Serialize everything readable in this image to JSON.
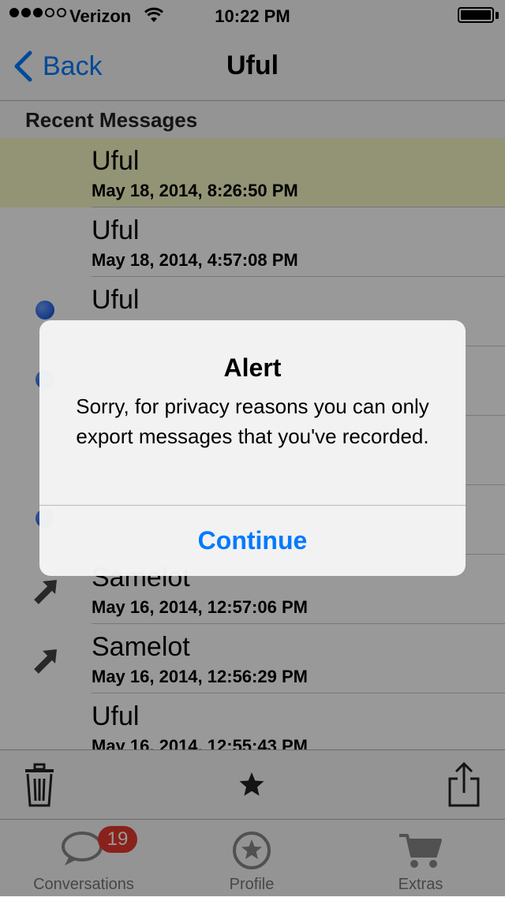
{
  "status_bar": {
    "carrier": "Verizon",
    "time": "10:22 PM",
    "signal_bars": 3,
    "signal_total": 5
  },
  "nav": {
    "back_label": "Back",
    "title": "Uful"
  },
  "section": {
    "title": "Recent Messages"
  },
  "messages": [
    {
      "name": "Uful",
      "date": "May 18, 2014, 8:26:50 PM",
      "indicator": "none",
      "highlighted": true
    },
    {
      "name": "Uful",
      "date": "May 18, 2014, 4:57:08 PM",
      "indicator": "none",
      "highlighted": false
    },
    {
      "name": "Uful",
      "date": "",
      "indicator": "unread-dot",
      "highlighted": false
    },
    {
      "name": "",
      "date": "",
      "indicator": "unread-dot",
      "highlighted": false
    },
    {
      "name": "",
      "date": "",
      "indicator": "none",
      "highlighted": false
    },
    {
      "name": "",
      "date": "",
      "indicator": "unread-dot",
      "highlighted": false
    },
    {
      "name": "Samelot",
      "date": "May 16, 2014, 12:57:06 PM",
      "indicator": "sent-arrow",
      "highlighted": false
    },
    {
      "name": "Samelot",
      "date": "May 16, 2014, 12:56:29 PM",
      "indicator": "sent-arrow",
      "highlighted": false
    },
    {
      "name": "Uful",
      "date": "May 16, 2014, 12:55:43 PM",
      "indicator": "none",
      "highlighted": false
    }
  ],
  "toolbar": {
    "icons": [
      "trash-icon",
      "star-icon",
      "share-icon"
    ]
  },
  "tabs": [
    {
      "label": "Conversations",
      "icon": "chat-bubble-icon",
      "badge": "19"
    },
    {
      "label": "Profile",
      "icon": "star-circle-icon"
    },
    {
      "label": "Extras",
      "icon": "cart-icon"
    }
  ],
  "alert": {
    "title": "Alert",
    "message": "Sorry, for privacy reasons you can only export messages that you've recorded.",
    "button": "Continue"
  },
  "colors": {
    "accent": "#007aff",
    "highlight_row": "#f4f7c4",
    "badge": "#e53a2e",
    "unread_dot": "#2f6fe6"
  }
}
